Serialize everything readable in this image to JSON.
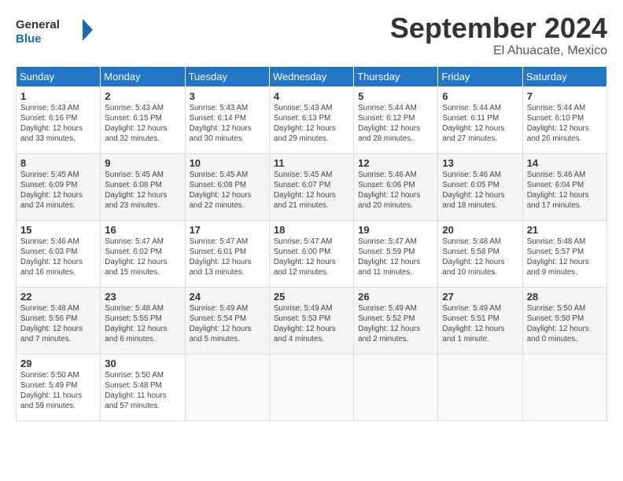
{
  "header": {
    "logo_line1": "General",
    "logo_line2": "Blue",
    "month": "September 2024",
    "location": "El Ahuacate, Mexico"
  },
  "weekdays": [
    "Sunday",
    "Monday",
    "Tuesday",
    "Wednesday",
    "Thursday",
    "Friday",
    "Saturday"
  ],
  "weeks": [
    [
      {
        "day": "1",
        "info": "Sunrise: 5:43 AM\nSunset: 6:16 PM\nDaylight: 12 hours\nand 33 minutes."
      },
      {
        "day": "2",
        "info": "Sunrise: 5:43 AM\nSunset: 6:15 PM\nDaylight: 12 hours\nand 32 minutes."
      },
      {
        "day": "3",
        "info": "Sunrise: 5:43 AM\nSunset: 6:14 PM\nDaylight: 12 hours\nand 30 minutes."
      },
      {
        "day": "4",
        "info": "Sunrise: 5:43 AM\nSunset: 6:13 PM\nDaylight: 12 hours\nand 29 minutes."
      },
      {
        "day": "5",
        "info": "Sunrise: 5:44 AM\nSunset: 6:12 PM\nDaylight: 12 hours\nand 28 minutes."
      },
      {
        "day": "6",
        "info": "Sunrise: 5:44 AM\nSunset: 6:11 PM\nDaylight: 12 hours\nand 27 minutes."
      },
      {
        "day": "7",
        "info": "Sunrise: 5:44 AM\nSunset: 6:10 PM\nDaylight: 12 hours\nand 26 minutes."
      }
    ],
    [
      {
        "day": "8",
        "info": "Sunrise: 5:45 AM\nSunset: 6:09 PM\nDaylight: 12 hours\nand 24 minutes."
      },
      {
        "day": "9",
        "info": "Sunrise: 5:45 AM\nSunset: 6:08 PM\nDaylight: 12 hours\nand 23 minutes."
      },
      {
        "day": "10",
        "info": "Sunrise: 5:45 AM\nSunset: 6:08 PM\nDaylight: 12 hours\nand 22 minutes."
      },
      {
        "day": "11",
        "info": "Sunrise: 5:45 AM\nSunset: 6:07 PM\nDaylight: 12 hours\nand 21 minutes."
      },
      {
        "day": "12",
        "info": "Sunrise: 5:46 AM\nSunset: 6:06 PM\nDaylight: 12 hours\nand 20 minutes."
      },
      {
        "day": "13",
        "info": "Sunrise: 5:46 AM\nSunset: 6:05 PM\nDaylight: 12 hours\nand 18 minutes."
      },
      {
        "day": "14",
        "info": "Sunrise: 5:46 AM\nSunset: 6:04 PM\nDaylight: 12 hours\nand 17 minutes."
      }
    ],
    [
      {
        "day": "15",
        "info": "Sunrise: 5:46 AM\nSunset: 6:03 PM\nDaylight: 12 hours\nand 16 minutes."
      },
      {
        "day": "16",
        "info": "Sunrise: 5:47 AM\nSunset: 6:02 PM\nDaylight: 12 hours\nand 15 minutes."
      },
      {
        "day": "17",
        "info": "Sunrise: 5:47 AM\nSunset: 6:01 PM\nDaylight: 12 hours\nand 13 minutes."
      },
      {
        "day": "18",
        "info": "Sunrise: 5:47 AM\nSunset: 6:00 PM\nDaylight: 12 hours\nand 12 minutes."
      },
      {
        "day": "19",
        "info": "Sunrise: 5:47 AM\nSunset: 5:59 PM\nDaylight: 12 hours\nand 11 minutes."
      },
      {
        "day": "20",
        "info": "Sunrise: 5:48 AM\nSunset: 5:58 PM\nDaylight: 12 hours\nand 10 minutes."
      },
      {
        "day": "21",
        "info": "Sunrise: 5:48 AM\nSunset: 5:57 PM\nDaylight: 12 hours\nand 9 minutes."
      }
    ],
    [
      {
        "day": "22",
        "info": "Sunrise: 5:48 AM\nSunset: 5:56 PM\nDaylight: 12 hours\nand 7 minutes."
      },
      {
        "day": "23",
        "info": "Sunrise: 5:48 AM\nSunset: 5:55 PM\nDaylight: 12 hours\nand 6 minutes."
      },
      {
        "day": "24",
        "info": "Sunrise: 5:49 AM\nSunset: 5:54 PM\nDaylight: 12 hours\nand 5 minutes."
      },
      {
        "day": "25",
        "info": "Sunrise: 5:49 AM\nSunset: 5:53 PM\nDaylight: 12 hours\nand 4 minutes."
      },
      {
        "day": "26",
        "info": "Sunrise: 5:49 AM\nSunset: 5:52 PM\nDaylight: 12 hours\nand 2 minutes."
      },
      {
        "day": "27",
        "info": "Sunrise: 5:49 AM\nSunset: 5:51 PM\nDaylight: 12 hours\nand 1 minute."
      },
      {
        "day": "28",
        "info": "Sunrise: 5:50 AM\nSunset: 5:50 PM\nDaylight: 12 hours\nand 0 minutes."
      }
    ],
    [
      {
        "day": "29",
        "info": "Sunrise: 5:50 AM\nSunset: 5:49 PM\nDaylight: 11 hours\nand 59 minutes."
      },
      {
        "day": "30",
        "info": "Sunrise: 5:50 AM\nSunset: 5:48 PM\nDaylight: 11 hours\nand 57 minutes."
      },
      {
        "day": "",
        "info": ""
      },
      {
        "day": "",
        "info": ""
      },
      {
        "day": "",
        "info": ""
      },
      {
        "day": "",
        "info": ""
      },
      {
        "day": "",
        "info": ""
      }
    ]
  ]
}
